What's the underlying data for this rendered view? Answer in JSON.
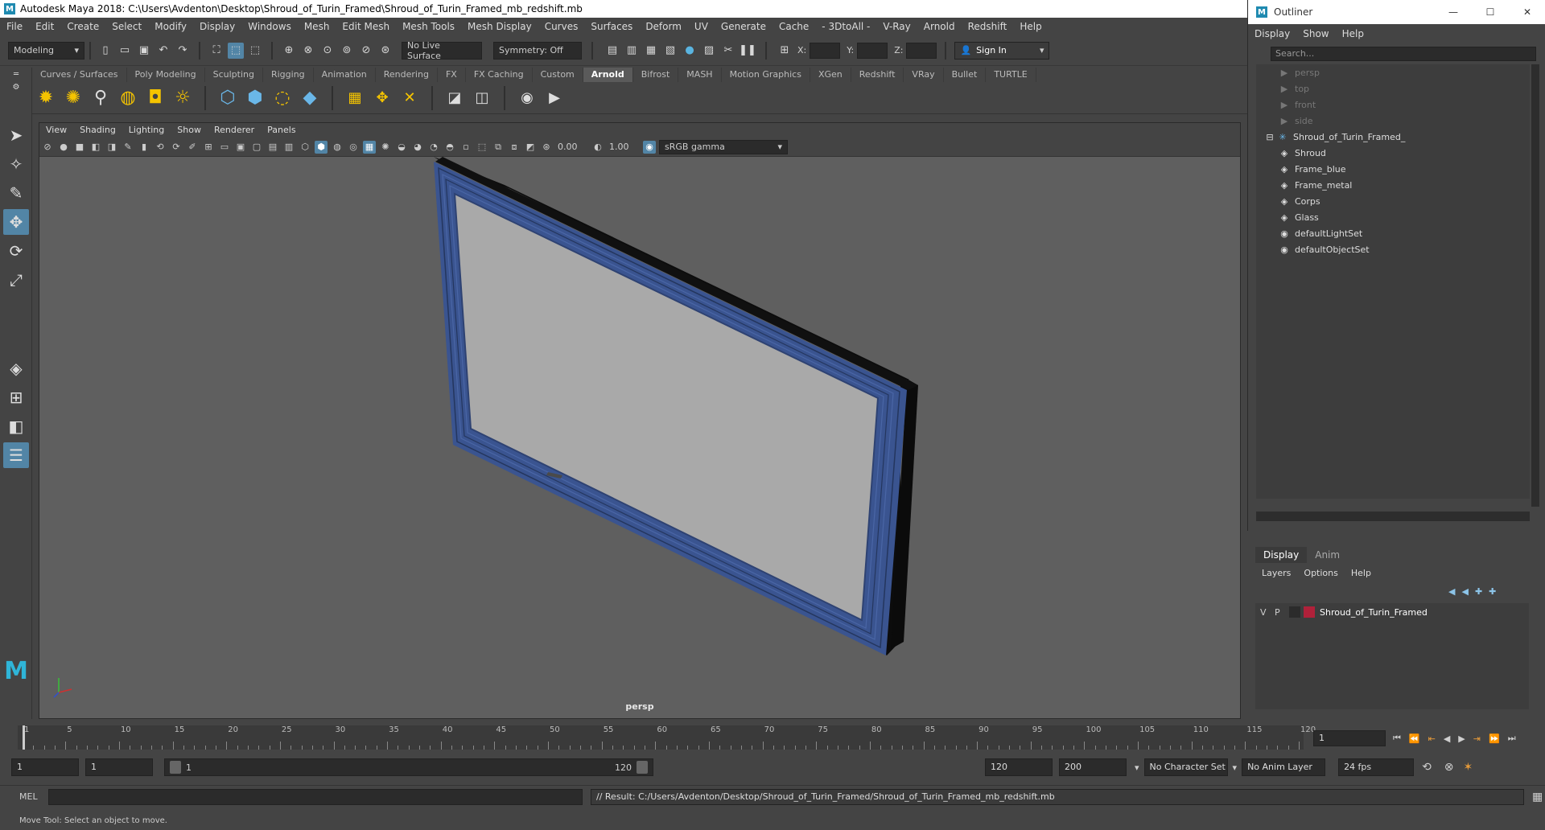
{
  "window_title": "Autodesk Maya 2018: C:\\Users\\Avdenton\\Desktop\\Shroud_of_Turin_Framed\\Shroud_of_Turin_Framed_mb_redshift.mb",
  "menu": [
    "File",
    "Edit",
    "Create",
    "Select",
    "Modify",
    "Display",
    "Windows",
    "Mesh",
    "Edit Mesh",
    "Mesh Tools",
    "Mesh Display",
    "Curves",
    "Surfaces",
    "Deform",
    "UV",
    "Generate",
    "Cache",
    "- 3DtoAll -",
    "V-Ray",
    "Arnold",
    "Redshift",
    "Help"
  ],
  "status": {
    "mode": "Modeling",
    "live_surface": "No Live Surface",
    "symmetry": "Symmetry: Off",
    "x_label": "X:",
    "y_label": "Y:",
    "z_label": "Z:",
    "sign_in": "Sign In"
  },
  "shelf_tabs": [
    "Curves / Surfaces",
    "Poly Modeling",
    "Sculpting",
    "Rigging",
    "Animation",
    "Rendering",
    "FX",
    "FX Caching",
    "Custom",
    "Arnold",
    "Bifrost",
    "MASH",
    "Motion Graphics",
    "XGen",
    "Redshift",
    "VRay",
    "Bullet",
    "TURTLE"
  ],
  "shelf_active_tab": "Arnold",
  "viewport": {
    "menu": [
      "View",
      "Shading",
      "Lighting",
      "Show",
      "Renderer",
      "Panels"
    ],
    "exposure": "0.00",
    "gamma": "1.00",
    "color_space": "sRGB gamma",
    "camera_label": "persp"
  },
  "outliner": {
    "title": "Outliner",
    "menu": [
      "Display",
      "Show",
      "Help"
    ],
    "search_placeholder": "Search...",
    "items": [
      {
        "label": "persp",
        "type": "camera",
        "dim": true
      },
      {
        "label": "top",
        "type": "camera",
        "dim": true
      },
      {
        "label": "front",
        "type": "camera",
        "dim": true
      },
      {
        "label": "side",
        "type": "camera",
        "dim": true
      },
      {
        "label": "Shroud_of_Turin_Framed_",
        "type": "group",
        "dim": false
      },
      {
        "label": "Shroud",
        "type": "mesh",
        "dim": false
      },
      {
        "label": "Frame_blue",
        "type": "mesh",
        "dim": false
      },
      {
        "label": "Frame_metal",
        "type": "mesh",
        "dim": false
      },
      {
        "label": "Corps",
        "type": "mesh",
        "dim": false
      },
      {
        "label": "Glass",
        "type": "mesh",
        "dim": false
      },
      {
        "label": "defaultLightSet",
        "type": "set",
        "dim": false
      },
      {
        "label": "defaultObjectSet",
        "type": "set",
        "dim": false
      }
    ]
  },
  "layer_editor": {
    "tabs": [
      "Display",
      "Anim"
    ],
    "menu": [
      "Layers",
      "Options",
      "Help"
    ],
    "layer": {
      "v": "V",
      "p": "P",
      "name": "Shroud_of_Turin_Framed",
      "color": "#b0213a"
    }
  },
  "timeline": {
    "ticks": [
      "5",
      "10",
      "15",
      "20",
      "25",
      "30",
      "35",
      "40",
      "45",
      "50",
      "55",
      "60",
      "65",
      "70",
      "75",
      "80",
      "85",
      "90",
      "95",
      "100",
      "105",
      "110",
      "115",
      "120"
    ],
    "start_tick": "1",
    "current_frame": "1"
  },
  "range": {
    "start": "1",
    "inner_start": "1",
    "slider_start": "1",
    "slider_end": "120",
    "end": "120",
    "outer_end": "200",
    "character_set": "No Character Set",
    "anim_layer": "No Anim Layer",
    "fps": "24 fps"
  },
  "command": {
    "lang": "MEL",
    "result": "// Result: C:/Users/Avdenton/Desktop/Shroud_of_Turin_Framed/Shroud_of_Turin_Framed_mb_redshift.mb"
  },
  "help_line": "Move Tool: Select an object to move.",
  "colors": {
    "accent": "#5285a6",
    "frame_blue": "#3a5490",
    "layer_color": "#b0213a"
  }
}
